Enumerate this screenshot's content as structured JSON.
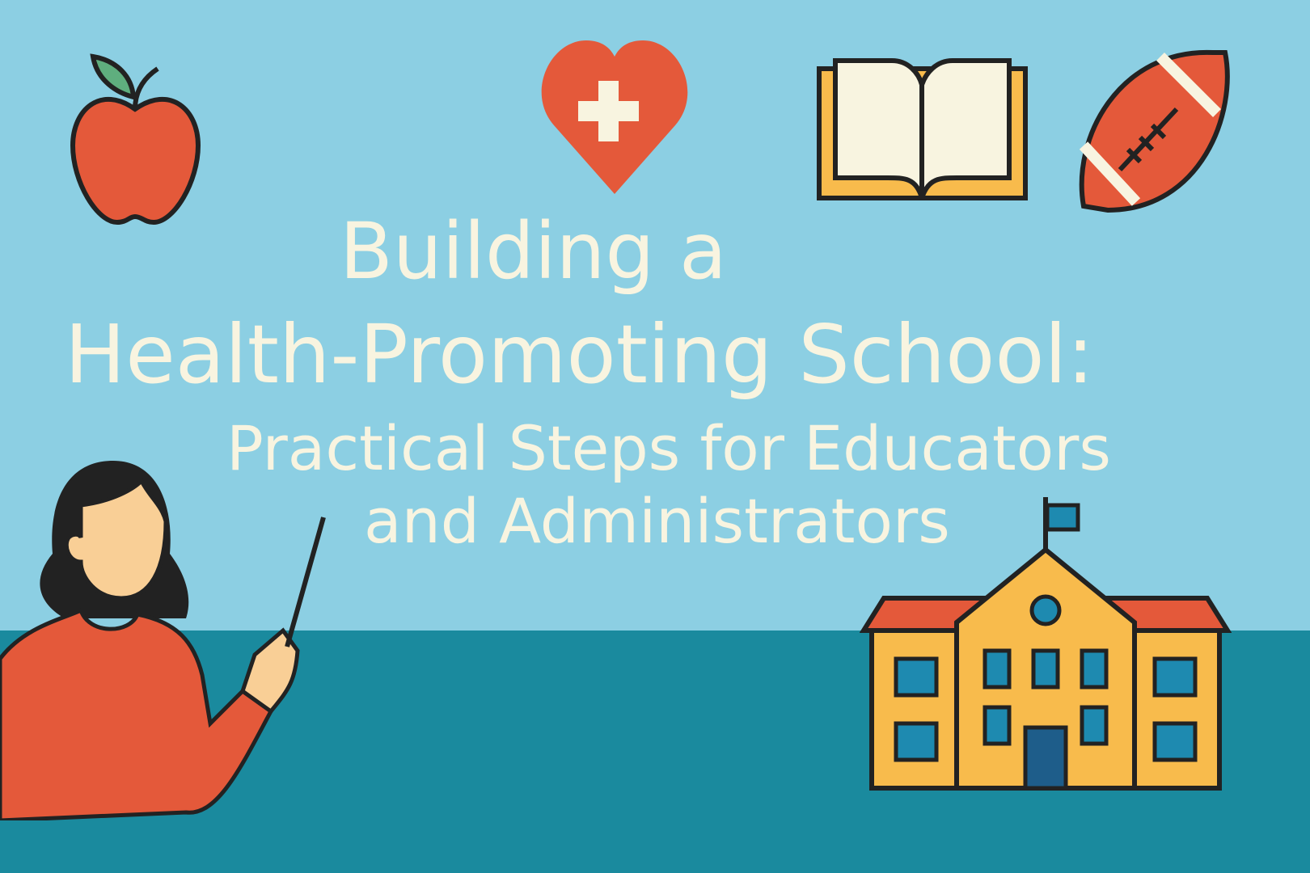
{
  "title": {
    "line1": "Building a",
    "line2": "Health-Promoting School:",
    "line3": "Practical Steps for Educators",
    "line4": "and Administrators"
  },
  "colors": {
    "sky": "#8ccfe3",
    "floor": "#1a8a9e",
    "red": "#e4593a",
    "yellow": "#f8bb4c",
    "cream": "#f8f4e0"
  }
}
